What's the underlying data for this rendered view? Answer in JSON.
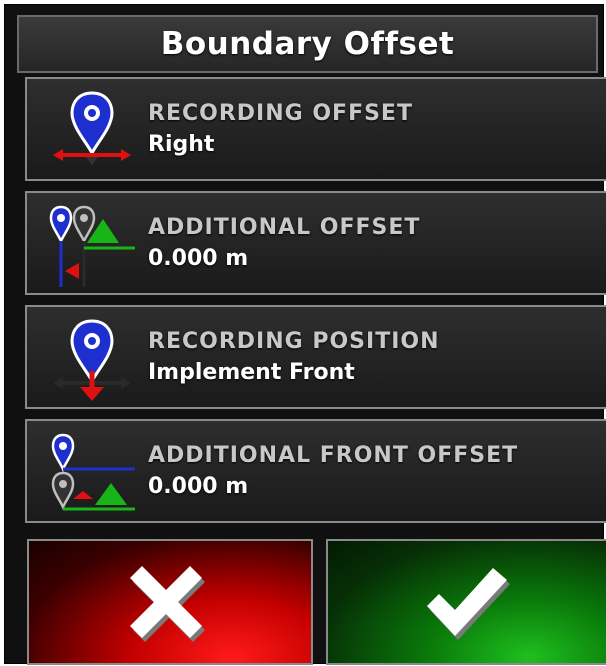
{
  "dialog": {
    "title": "Boundary Offset"
  },
  "settings": [
    {
      "label": "RECORDING OFFSET",
      "value": "Right",
      "icon": "recording-offset-icon"
    },
    {
      "label": "ADDITIONAL OFFSET",
      "value": "0.000 m",
      "icon": "additional-offset-icon"
    },
    {
      "label": "RECORDING POSITION",
      "value": "Implement Front",
      "icon": "recording-position-icon"
    },
    {
      "label": "ADDITIONAL FRONT OFFSET",
      "value": "0.000 m",
      "icon": "additional-front-offset-icon"
    }
  ],
  "buttons": {
    "cancel_icon": "x-icon",
    "confirm_icon": "checkmark-icon"
  },
  "colors": {
    "pin_blue": "#1e2fd0",
    "arrow_red": "#e01010",
    "triangle_green": "#17b517",
    "cancel_red": "#e00000",
    "confirm_green": "#0fa00f"
  }
}
